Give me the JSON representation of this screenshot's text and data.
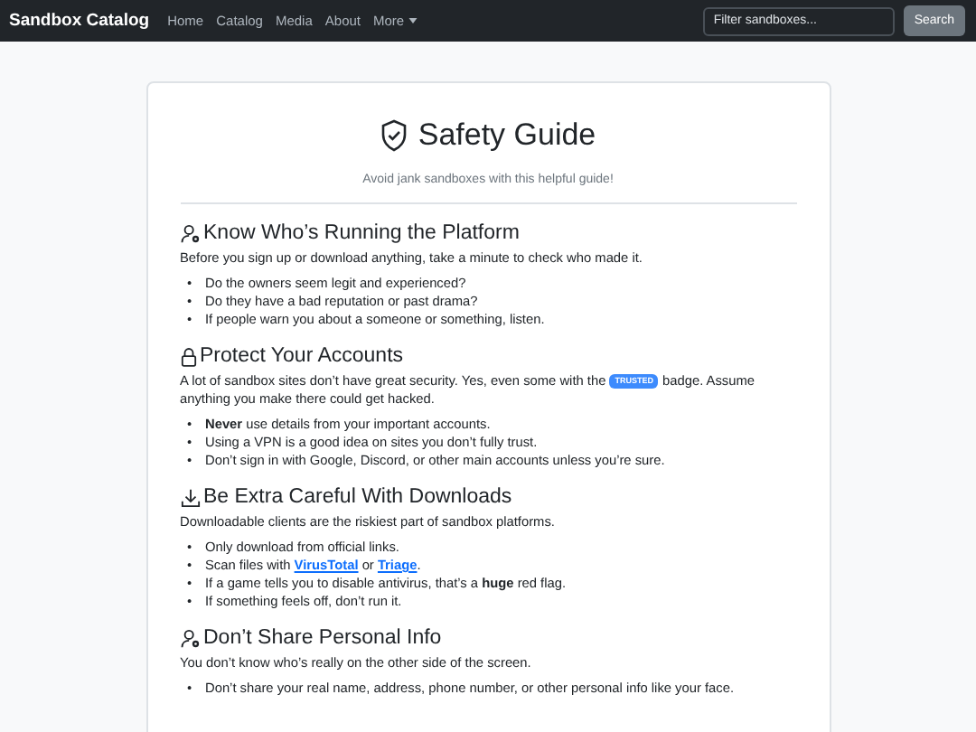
{
  "navbar": {
    "brand": "Sandbox Catalog",
    "links": [
      {
        "label": "Home",
        "dropdown": false
      },
      {
        "label": "Catalog",
        "dropdown": false
      },
      {
        "label": "Media",
        "dropdown": false
      },
      {
        "label": "About",
        "dropdown": false
      },
      {
        "label": "More",
        "dropdown": true
      }
    ],
    "search": {
      "placeholder": "Filter sandboxes..."
    },
    "search_button": "Search"
  },
  "guide": {
    "title": "Safety Guide",
    "subtitle": "Avoid jank sandboxes with this helpful guide!",
    "sections": [
      {
        "heading": "Know Who’s Running the Platform",
        "paragraph": [
          {
            "kind": "text",
            "text": "Before you sign up or download anything, take a minute to check who made it."
          }
        ],
        "items": [
          {
            "marker": "•",
            "parts": [
              {
                "kind": "text",
                "text": "Do the owners seem legit and experienced?"
              }
            ]
          },
          {
            "marker": "•",
            "parts": [
              {
                "kind": "text",
                "text": "Do they have a bad reputation or past drama?"
              }
            ]
          },
          {
            "marker": "•",
            "parts": [
              {
                "kind": "text",
                "text": "If people warn you about a someone or something, listen."
              }
            ]
          }
        ]
      },
      {
        "heading": "Protect Your Accounts",
        "paragraph": [
          {
            "kind": "text",
            "text": "A lot of sandbox sites don’t have great security. Yes, even some with the "
          },
          {
            "kind": "badge",
            "text": "TRUSTED"
          },
          {
            "kind": "text",
            "text": " badge. Assume anything you make there could get hacked."
          }
        ],
        "items": [
          {
            "marker": "•",
            "parts": [
              {
                "kind": "text",
                "text": "**Never** use details from your important accounts."
              }
            ]
          },
          {
            "marker": "•",
            "parts": [
              {
                "kind": "text",
                "text": "Using a VPN is a good idea on sites you don’t fully trust."
              }
            ]
          },
          {
            "marker": "•",
            "parts": [
              {
                "kind": "text",
                "text": "Don’t sign in with Google, Discord, or other main accounts unless you’re sure."
              }
            ]
          }
        ]
      },
      {
        "heading": "Be Extra Careful With Downloads",
        "paragraph": [
          {
            "kind": "text",
            "text": "Downloadable clients are the riskiest part of sandbox platforms."
          }
        ],
        "items": [
          {
            "marker": "•",
            "parts": [
              {
                "kind": "text",
                "text": "Only download from official links."
              }
            ]
          },
          {
            "marker": "•",
            "parts": [
              {
                "kind": "text",
                "text": "Scan files with "
              },
              {
                "kind": "link",
                "text": "VirusTotal"
              },
              {
                "kind": "text",
                "text": " or "
              },
              {
                "kind": "link",
                "text": "Triage"
              },
              {
                "kind": "text",
                "text": "."
              }
            ]
          },
          {
            "marker": "•",
            "parts": [
              {
                "kind": "text",
                "text": "If a game tells you to disable antivirus, that’s a **huge** red flag."
              }
            ]
          },
          {
            "marker": "•",
            "parts": [
              {
                "kind": "text",
                "text": "If something feels off, don’t run it."
              }
            ]
          }
        ]
      },
      {
        "heading": "Don’t Share Personal Info",
        "paragraph": [
          {
            "kind": "text",
            "text": "You don’t know who’s really on the other side of the screen."
          }
        ],
        "items": [
          {
            "marker": "•",
            "parts": [
              {
                "kind": "text",
                "text": "Don’t share your real name, address, phone number, or other personal info like your face."
              }
            ]
          }
        ]
      }
    ]
  }
}
